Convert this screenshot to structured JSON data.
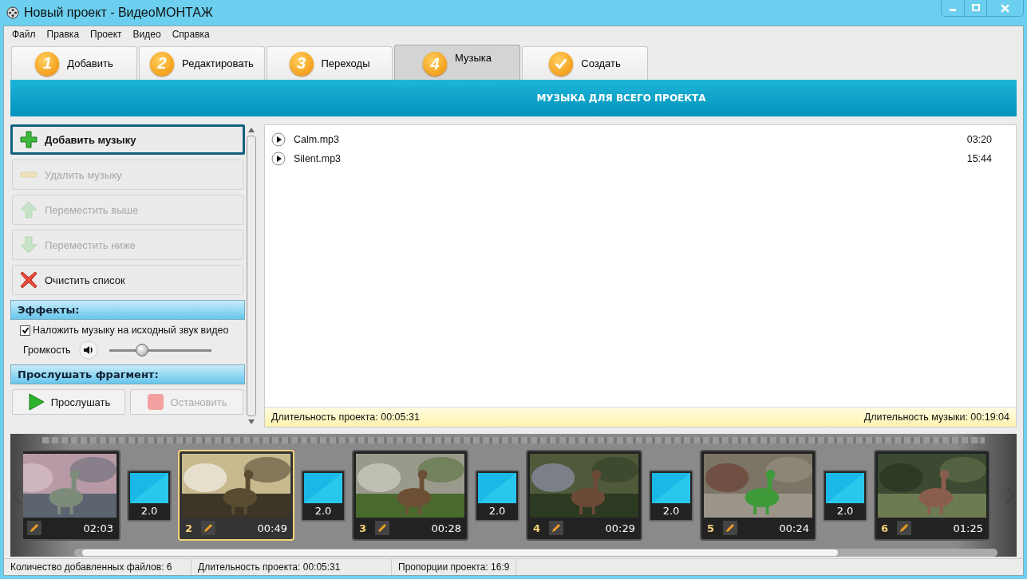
{
  "window": {
    "title": "Новый проект - ВидеоМОНТАЖ"
  },
  "menu": [
    "Файл",
    "Правка",
    "Проект",
    "Видео",
    "Справка"
  ],
  "tabs": [
    {
      "kind": "number",
      "number": "1",
      "label": "Добавить",
      "selected": false
    },
    {
      "kind": "number",
      "number": "2",
      "label": "Редактировать",
      "selected": false
    },
    {
      "kind": "number",
      "number": "3",
      "label": "Переходы",
      "selected": false
    },
    {
      "kind": "number",
      "number": "4",
      "label": "Музыка",
      "selected": true
    },
    {
      "kind": "check",
      "label": "Создать",
      "selected": false
    }
  ],
  "banner": "МУЗЫКА ДЛЯ ВСЕГО ПРОЕКТА",
  "actions": [
    {
      "kind": "add",
      "label": "Добавить музыку",
      "disabled": false,
      "focused": true
    },
    {
      "kind": "remove",
      "label": "Удалить музыку",
      "disabled": true,
      "focused": false
    },
    {
      "kind": "up",
      "label": "Переместить выше",
      "disabled": true,
      "focused": false
    },
    {
      "kind": "down",
      "label": "Переместить ниже",
      "disabled": true,
      "focused": false
    },
    {
      "kind": "clear",
      "label": "Очистить список",
      "disabled": false,
      "focused": false
    }
  ],
  "effects": {
    "heading": "Эффекты:",
    "overlay": {
      "label": "Наложить музыку на исходный звук видео",
      "checked": true
    },
    "volume": {
      "label": "Громкость",
      "level": 0.32
    }
  },
  "preview": {
    "heading": "Прослушать фрагмент:",
    "buttons": [
      {
        "kind": "play",
        "label": "Прослушать",
        "disabled": false
      },
      {
        "kind": "stop",
        "label": "Остановить",
        "disabled": true
      }
    ]
  },
  "tracks": [
    {
      "name": "Calm.mp3",
      "duration": "03:20"
    },
    {
      "name": "Silent.mp3",
      "duration": "15:44"
    }
  ],
  "summary": {
    "project": "Длительность проекта: 00:05:31",
    "music": "Длительность музыки: 00:19:04"
  },
  "timeline": [
    {
      "kind": "clip",
      "duration": "02:03",
      "selected": false
    },
    {
      "kind": "transition",
      "duration": "2.0"
    },
    {
      "kind": "clip",
      "number": "2",
      "duration": "00:49",
      "selected": true
    },
    {
      "kind": "transition",
      "duration": "2.0"
    },
    {
      "kind": "clip",
      "number": "3",
      "duration": "00:28",
      "selected": false
    },
    {
      "kind": "transition",
      "duration": "2.0"
    },
    {
      "kind": "clip",
      "number": "4",
      "duration": "00:29",
      "selected": false
    },
    {
      "kind": "transition",
      "duration": "2.0"
    },
    {
      "kind": "clip",
      "number": "5",
      "duration": "00:24",
      "selected": false
    },
    {
      "kind": "transition",
      "duration": "2.0"
    },
    {
      "kind": "clip",
      "number": "6",
      "duration": "01:25",
      "selected": false
    }
  ],
  "status_bar": [
    "Количество добавленных файлов: 6",
    "Длительность проекта:  00:05:31",
    "Пропорции проекта:  16:9"
  ]
}
